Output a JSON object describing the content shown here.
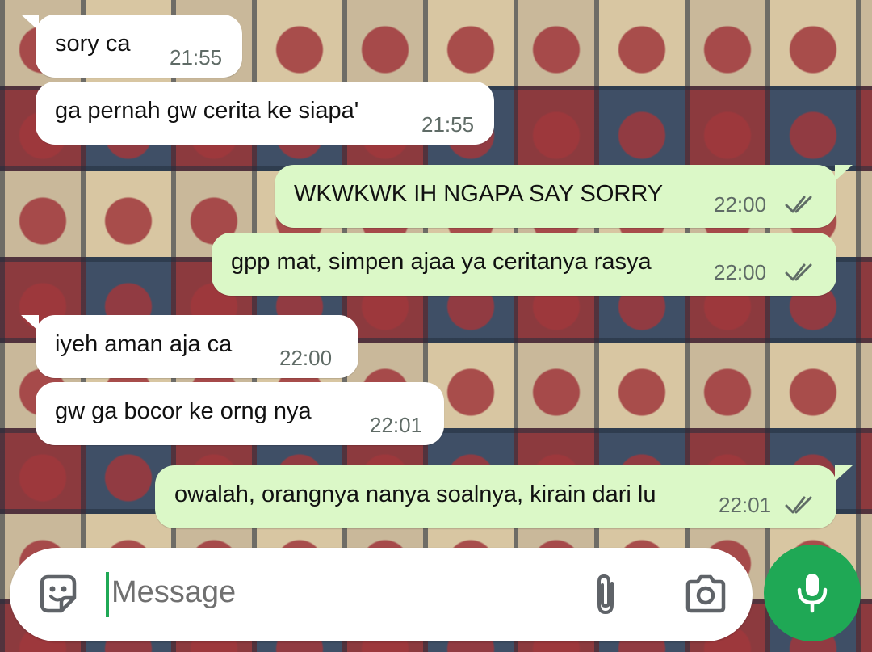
{
  "messages": [
    {
      "direction": "in",
      "text": "sory ca",
      "time": "21:55"
    },
    {
      "direction": "in",
      "text": "ga pernah gw cerita ke siapa'",
      "time": "21:55"
    },
    {
      "direction": "out",
      "text": "WKWKWK IH NGAPA SAY SORRY",
      "time": "22:00",
      "status": "read"
    },
    {
      "direction": "out",
      "text": "gpp mat, simpen ajaa ya ceritanya rasya",
      "time": "22:00",
      "status": "read"
    },
    {
      "direction": "in",
      "text": "iyeh aman aja ca",
      "time": "22:00"
    },
    {
      "direction": "in",
      "text": "gw ga bocor ke orng nya",
      "time": "22:01"
    },
    {
      "direction": "out",
      "text": "owalah, orangnya nanya soalnya, kirain dari lu",
      "time": "22:01",
      "status": "read"
    }
  ],
  "composer": {
    "placeholder": "Message",
    "icons": [
      "sticker-icon",
      "attach-icon",
      "camera-icon",
      "mic-icon"
    ]
  },
  "colors": {
    "incoming_bubble": "#ffffff",
    "outgoing_bubble": "#dbf8c7",
    "accent": "#1fa855",
    "tick": "#5f6b66"
  }
}
